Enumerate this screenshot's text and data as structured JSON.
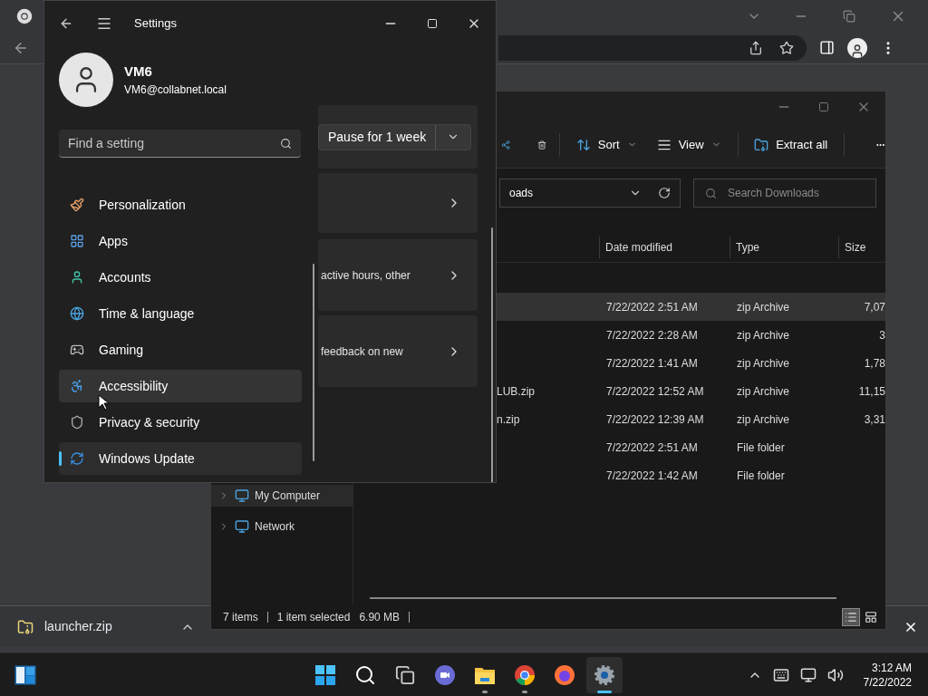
{
  "browser": {
    "download_bar": {
      "file": "launcher.zip"
    }
  },
  "explorer": {
    "toolbar": [
      {
        "label": "Sort",
        "kind": "menu"
      },
      {
        "label": "View",
        "kind": "menu"
      },
      {
        "label": "Extract all",
        "kind": "button"
      }
    ],
    "address": "oads",
    "search": {
      "placeholder": "Search Downloads"
    },
    "columns": [
      "Date modified",
      "Type",
      "Size"
    ],
    "rows": [
      {
        "date": "7/22/2022 2:51 AM",
        "type": "zip Archive",
        "size": "7,07",
        "selected": true
      },
      {
        "date": "7/22/2022 2:28 AM",
        "type": "zip Archive",
        "size": "3",
        "selected": false
      },
      {
        "date": "7/22/2022 1:41 AM",
        "type": "zip Archive",
        "size": "1,78",
        "selected": false
      },
      {
        "name": "LUB.zip",
        "date": "7/22/2022 12:52 AM",
        "type": "zip Archive",
        "size": "11,15",
        "selected": false
      },
      {
        "name": "n.zip",
        "date": "7/22/2022 12:39 AM",
        "type": "zip Archive",
        "size": "3,31",
        "selected": false
      },
      {
        "date": "7/22/2022 2:51 AM",
        "type": "File folder",
        "selected": false
      },
      {
        "date": "7/22/2022 1:42 AM",
        "type": "File folder",
        "selected": false
      }
    ],
    "nav": [
      {
        "label": "My Computer",
        "selected": true
      },
      {
        "label": "Network",
        "selected": false
      }
    ],
    "status": {
      "count": "7 items",
      "selection": "1 item selected",
      "size": "6.90 MB"
    },
    "view_buttons": [
      {
        "kind": "details",
        "selected": true
      },
      {
        "kind": "tiles",
        "selected": false
      }
    ]
  },
  "settings": {
    "title": "Settings",
    "user": {
      "name": "VM6",
      "email": "VM6@collabnet.local"
    },
    "search": {
      "placeholder": "Find a setting"
    },
    "nav": [
      {
        "label": "Personalization",
        "selected": false,
        "hovered": false
      },
      {
        "label": "Apps",
        "selected": false,
        "hovered": false
      },
      {
        "label": "Accounts",
        "selected": false,
        "hovered": false
      },
      {
        "label": "Time & language",
        "selected": false,
        "hovered": false
      },
      {
        "label": "Gaming",
        "selected": false,
        "hovered": false
      },
      {
        "label": "Accessibility",
        "selected": false,
        "hovered": true
      },
      {
        "label": "Privacy & security",
        "selected": false,
        "hovered": false
      },
      {
        "label": "Windows Update",
        "selected": true,
        "hovered": false
      }
    ],
    "pause_button": "Pause for 1 week",
    "cards": [
      {
        "text": "active hours, other"
      },
      {
        "text": "feedback on new"
      }
    ]
  },
  "taskbar": {
    "apps": [
      {
        "selected": false,
        "running": false
      },
      {
        "selected": false,
        "running": false
      },
      {
        "selected": false,
        "running": false
      },
      {
        "selected": false,
        "running": false
      },
      {
        "selected": false,
        "running": true
      },
      {
        "selected": false,
        "running": true
      },
      {
        "selected": false,
        "running": false
      },
      {
        "selected": true,
        "running": true
      }
    ],
    "time": "3:12 AM",
    "date": "7/22/2022"
  }
}
